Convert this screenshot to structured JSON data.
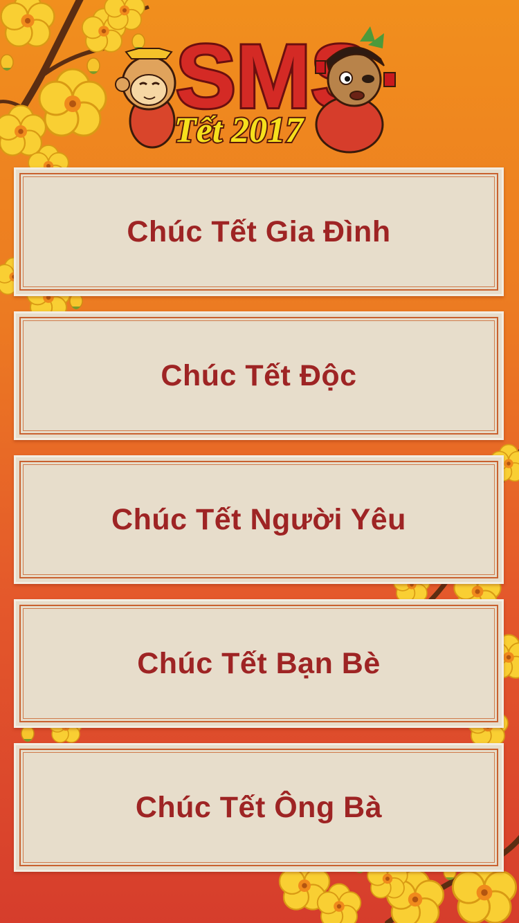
{
  "app": {
    "logo_text": "SMS",
    "logo_subtitle": "Tết 2017"
  },
  "menu": {
    "items": [
      {
        "label": "Chúc Tết Gia Đình"
      },
      {
        "label": "Chúc Tết Độc"
      },
      {
        "label": "Chúc Tết Người Yêu"
      },
      {
        "label": "Chúc Tết Bạn Bè"
      },
      {
        "label": "Chúc Tết Ông Bà"
      }
    ]
  },
  "colors": {
    "background_top": "#f18f1d",
    "background_bottom": "#d63d2c",
    "button_fill": "#e7ddcb",
    "button_border": "#c9612f",
    "label_text": "#9e2424",
    "blossom": "#f6c324"
  },
  "icons": [
    "apricot-blossom-icon",
    "monkey-mascot-icon",
    "boy-mascot-icon"
  ]
}
